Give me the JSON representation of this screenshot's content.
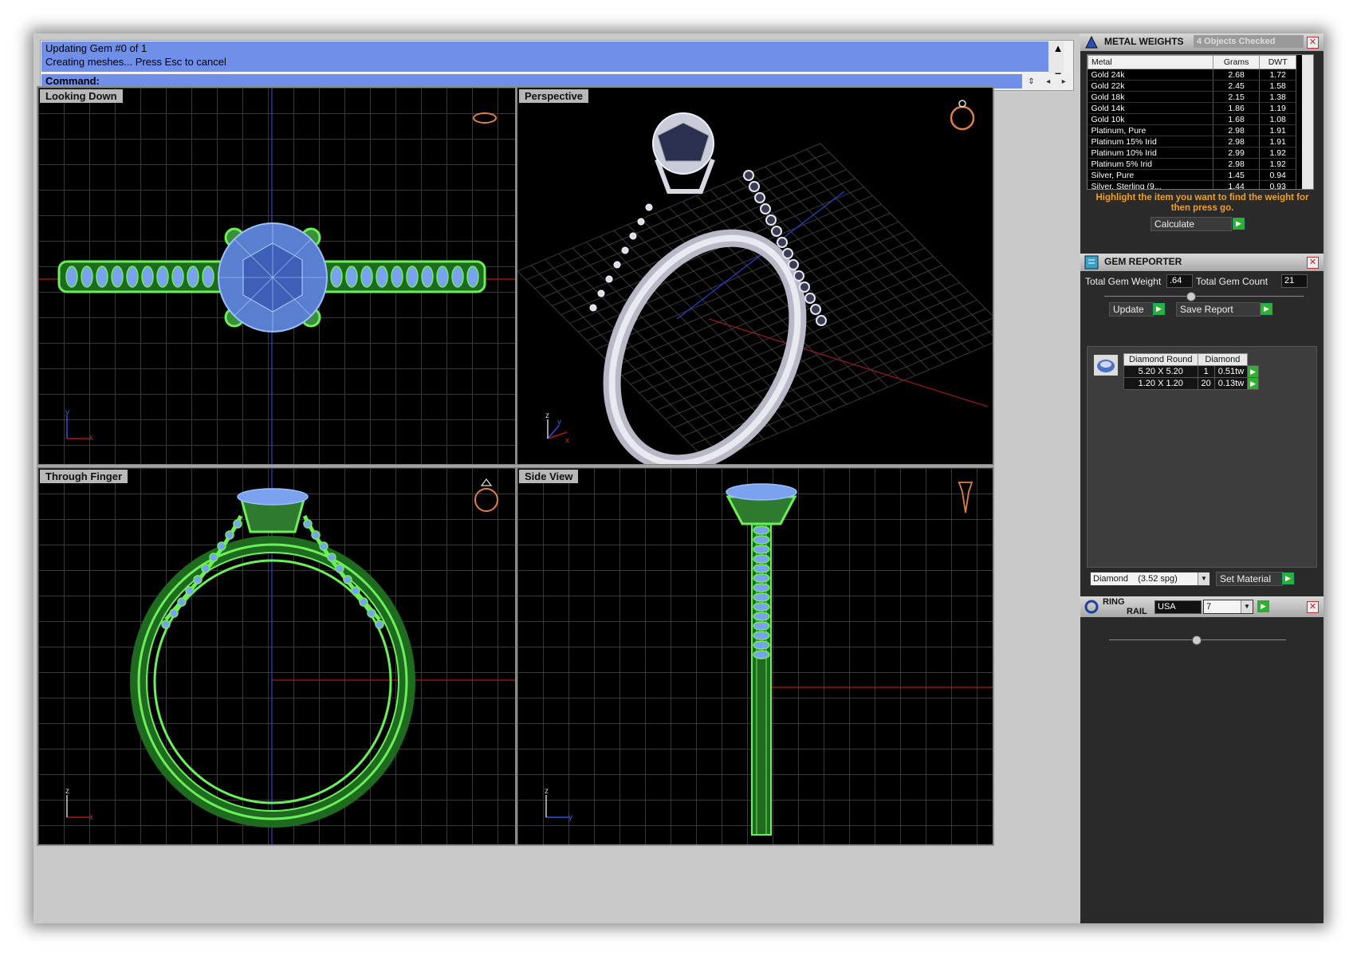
{
  "command": {
    "history": [
      "Updating Gem #0 of 1",
      "Creating meshes... Press Esc to cancel"
    ],
    "prompt_label": "Command:"
  },
  "viewports": {
    "top_left": "Looking Down",
    "top_right": "Perspective",
    "bottom_left": "Through Finger",
    "bottom_right": "Side View"
  },
  "axes": {
    "x": "x",
    "y": "y",
    "z": "z"
  },
  "metal_weights": {
    "title": "METAL WEIGHTS",
    "status": "4 Objects Checked",
    "columns": [
      "Metal",
      "Grams",
      "DWT"
    ],
    "rows": [
      [
        "Gold 24k",
        "2.68",
        "1.72"
      ],
      [
        "Gold 22k",
        "2.45",
        "1.58"
      ],
      [
        "Gold 18k",
        "2.15",
        "1.38"
      ],
      [
        "Gold 14k",
        "1.86",
        "1.19"
      ],
      [
        "Gold 10k",
        "1.68",
        "1.08"
      ],
      [
        "Platinum, Pure",
        "2.98",
        "1.91"
      ],
      [
        "Platinum 15% Irid",
        "2.98",
        "1.91"
      ],
      [
        "Platinum 10% Irid",
        "2.99",
        "1.92"
      ],
      [
        "Platinum 5% Irid",
        "2.98",
        "1.92"
      ],
      [
        "Silver, Pure",
        "1.45",
        "0.94"
      ],
      [
        "Silver, Sterling (9...",
        "1.44",
        "0.93"
      ]
    ],
    "note": "Highlight the item you want to find the weight for then press go.",
    "calculate_label": "Calculate"
  },
  "gem_reporter": {
    "title": "GEM REPORTER",
    "total_weight_label": "Total Gem Weight",
    "total_weight_value": ".64",
    "total_count_label": "Total Gem Count",
    "total_count_value": "21",
    "update_label": "Update",
    "save_report_label": "Save Report",
    "table_headers": [
      "Diamond Round",
      "Diamond"
    ],
    "rows": [
      {
        "size": "5.20 X 5.20",
        "count": "1",
        "weight": "0.51tw"
      },
      {
        "size": "1.20 X 1.20",
        "count": "20",
        "weight": "0.13tw"
      }
    ],
    "material_select": "Diamond    (3.52 spg)",
    "set_material_label": "Set Material"
  },
  "ring_rail": {
    "title_line1": "RING",
    "title_line2": "RAIL",
    "region": "USA",
    "size": "7"
  },
  "colors": {
    "wire_green": "#6cf05a",
    "gem_blue": "#7aa2ee",
    "command_bg": "#6f8fe8",
    "accent_orange": "#f0a020"
  }
}
